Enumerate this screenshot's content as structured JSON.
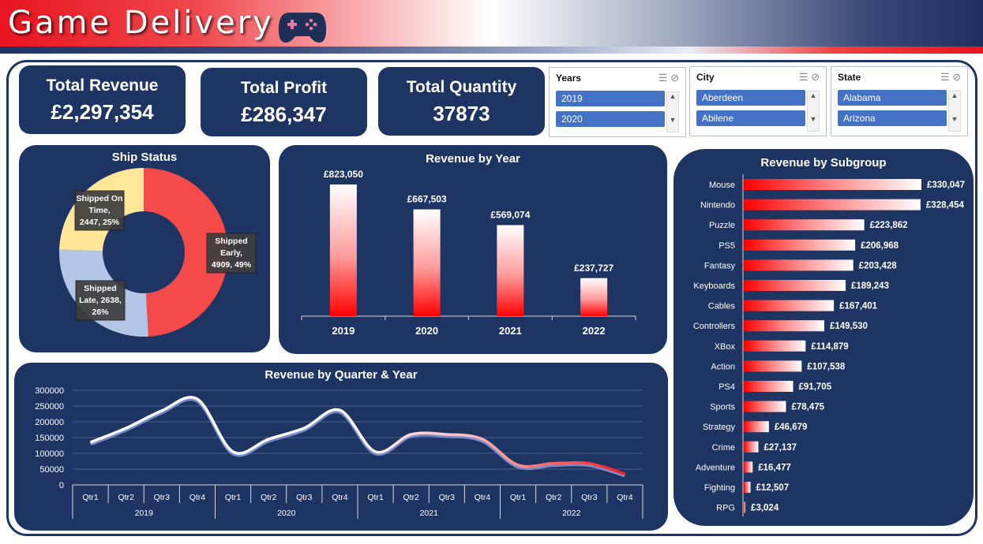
{
  "header": {
    "title": "Game Delivery",
    "icon": "gamepad-icon"
  },
  "kpis": [
    {
      "title": "Total Revenue",
      "value": "£2,297,354"
    },
    {
      "title": "Total Profit",
      "value": "£286,347"
    },
    {
      "title": "Total Quantity",
      "value": "37873"
    }
  ],
  "slicers": [
    {
      "title": "Years",
      "items": [
        "2019",
        "2020"
      ]
    },
    {
      "title": "City",
      "items": [
        "Aberdeen",
        "Abilene"
      ]
    },
    {
      "title": "State",
      "items": [
        "Alabama",
        "Arizona"
      ]
    }
  ],
  "colors": {
    "navy": "#1e3462",
    "red": "#ff0000",
    "donut_red": "#f54a4a",
    "donut_blue": "#b4c6e7",
    "donut_yellow": "#ffe699"
  },
  "chart_data": [
    {
      "type": "pie",
      "title": "Ship Status",
      "slices": [
        {
          "label": "Shipped Early",
          "value": 4909,
          "percent": 49,
          "color": "#f54a4a",
          "label_lines": [
            "Shipped",
            "Early,",
            "4909, 49%"
          ]
        },
        {
          "label": "Shipped Late",
          "value": 2638,
          "percent": 26,
          "color": "#b4c6e7",
          "label_lines": [
            "Shipped",
            "Late, 2638,",
            "26%"
          ]
        },
        {
          "label": "Shipped On Time",
          "value": 2447,
          "percent": 25,
          "color": "#ffe699",
          "label_lines": [
            "Shipped On",
            "Time,",
            "2447, 25%"
          ]
        }
      ]
    },
    {
      "type": "bar",
      "title": "Revenue by Year",
      "categories": [
        "2019",
        "2020",
        "2021",
        "2022"
      ],
      "values": [
        823050,
        667503,
        569074,
        237727
      ],
      "labels": [
        "£823,050",
        "£667,503",
        "£569,074",
        "£237,727"
      ]
    },
    {
      "type": "bar",
      "orientation": "horizontal",
      "title": "Revenue by Subgroup",
      "categories": [
        "Mouse",
        "Nintendo",
        "Puzzle",
        "PS5",
        "Fantasy",
        "Keyboards",
        "Cables",
        "Controllers",
        "XBox",
        "Action",
        "PS4",
        "Sports",
        "Strategy",
        "Crime",
        "Adventure",
        "Fighting",
        "RPG"
      ],
      "values": [
        330047,
        328454,
        223862,
        206968,
        203428,
        189243,
        167401,
        149530,
        114879,
        107538,
        91705,
        78475,
        46679,
        27137,
        16477,
        12507,
        3024
      ],
      "labels": [
        "£330,047",
        "£328,454",
        "£223,862",
        "£206,968",
        "£203,428",
        "£189,243",
        "£167,401",
        "£149,530",
        "£114,879",
        "£107,538",
        "£91,705",
        "£78,475",
        "£46,679",
        "£27,137",
        "£16,477",
        "£12,507",
        "£3,024"
      ]
    },
    {
      "type": "line",
      "title": "Revenue by Quarter  & Year",
      "quarters": [
        "Qtr1",
        "Qtr2",
        "Qtr3",
        "Qtr4",
        "Qtr1",
        "Qtr2",
        "Qtr3",
        "Qtr4",
        "Qtr1",
        "Qtr2",
        "Qtr3",
        "Qtr4",
        "Qtr1",
        "Qtr2",
        "Qtr3",
        "Qtr4"
      ],
      "years": [
        "2019",
        "2020",
        "2021",
        "2022"
      ],
      "values": [
        135000,
        180000,
        235000,
        272000,
        105000,
        145000,
        180000,
        237000,
        105000,
        160000,
        160000,
        145000,
        63000,
        68000,
        68000,
        35000
      ],
      "ylim": [
        0,
        300000
      ],
      "yticks": [
        "300000",
        "250000",
        "200000",
        "150000",
        "100000",
        "50000",
        "0"
      ]
    }
  ]
}
